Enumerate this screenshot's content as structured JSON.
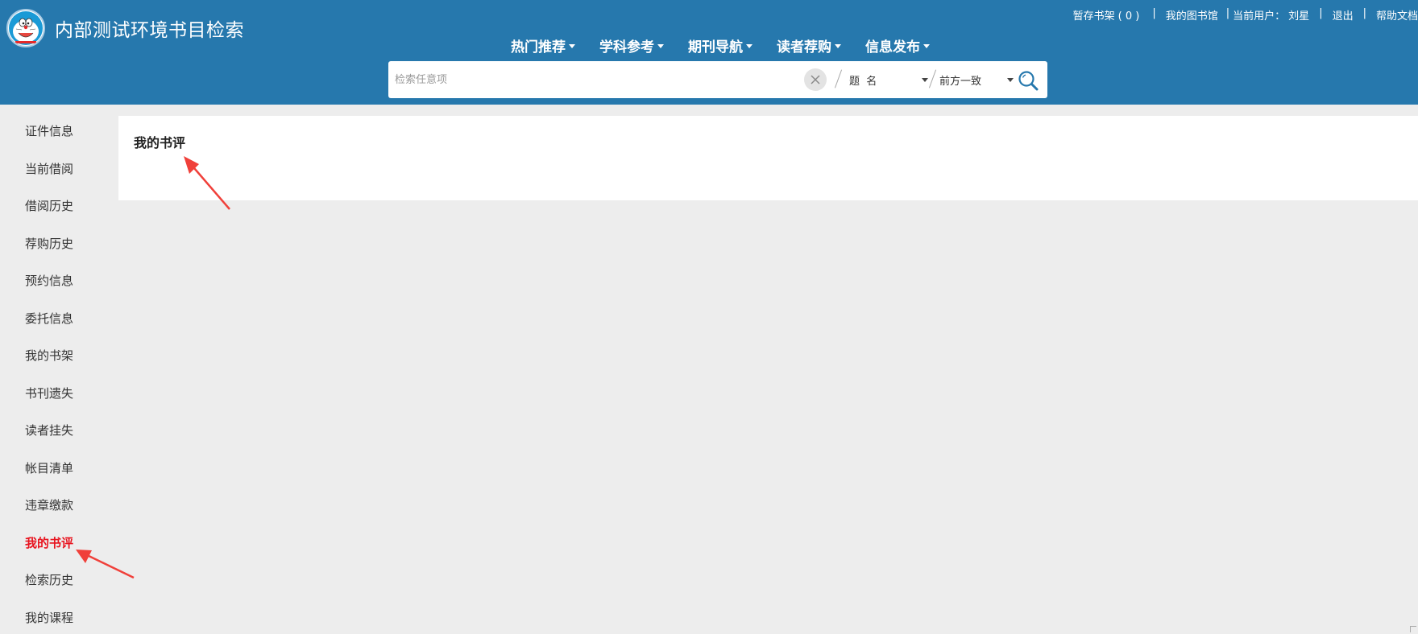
{
  "header": {
    "site_title": "内部测试环境书目检索",
    "toplinks": {
      "shelf": "暂存书架",
      "shelf_count": "( 0 )",
      "sep1": "|",
      "my_library": "我的图书馆",
      "sep2": "|",
      "current_user_label": "当前用户：",
      "current_user_name": "刘星",
      "sep3": "|",
      "logout": "退出",
      "sep4": "|",
      "help": "帮助文档"
    },
    "nav": [
      {
        "label": "热门推荐"
      },
      {
        "label": "学科参考"
      },
      {
        "label": "期刊导航"
      },
      {
        "label": "读者荐购"
      },
      {
        "label": "信息发布"
      }
    ]
  },
  "search": {
    "placeholder": "检索任意项",
    "value": "",
    "field": "题  名",
    "match": "前方一致"
  },
  "sidebar": {
    "items": [
      {
        "label": "证件信息"
      },
      {
        "label": "当前借阅"
      },
      {
        "label": "借阅历史"
      },
      {
        "label": "荐购历史"
      },
      {
        "label": "预约信息"
      },
      {
        "label": "委托信息"
      },
      {
        "label": "我的书架"
      },
      {
        "label": "书刊遗失"
      },
      {
        "label": "读者挂失"
      },
      {
        "label": "帐目清单"
      },
      {
        "label": "违章缴款"
      },
      {
        "label": "我的书评"
      },
      {
        "label": "检索历史"
      },
      {
        "label": "我的课程"
      }
    ],
    "active_index": 11
  },
  "main": {
    "title": "我的书评"
  },
  "colors": {
    "header_bg": "#2678ad",
    "page_bg": "#ededed",
    "active": "#e8141f",
    "annotation_arrow": "#f0403a"
  }
}
